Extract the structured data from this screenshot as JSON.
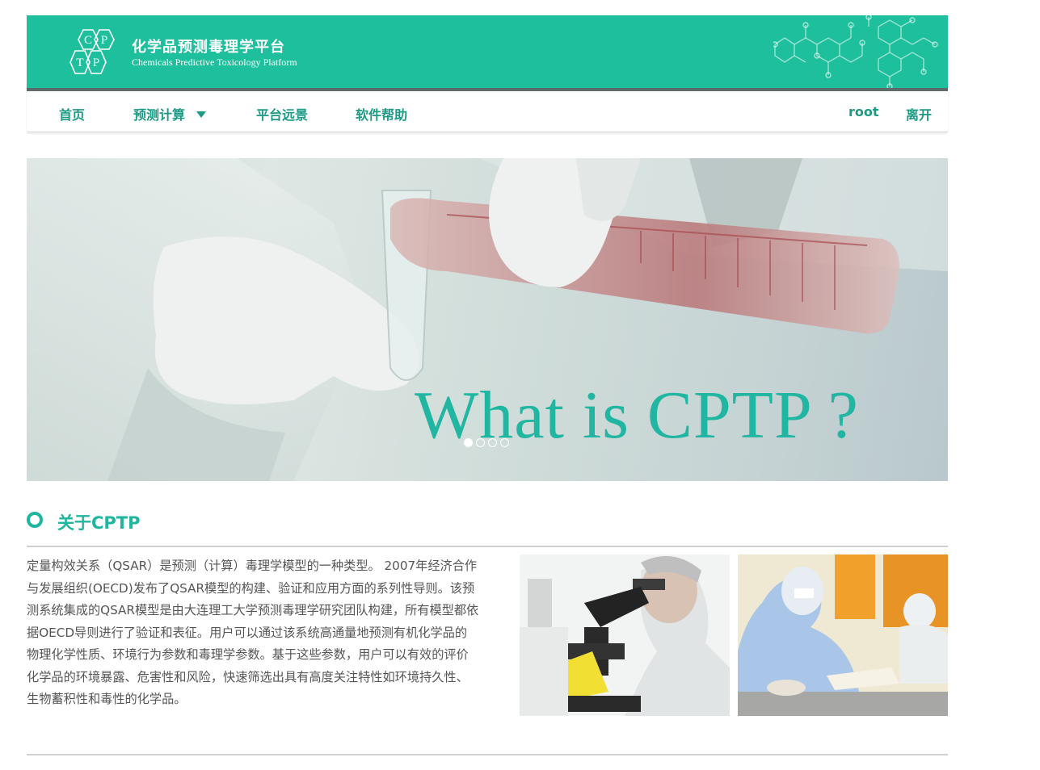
{
  "header": {
    "logo_letters": [
      "C",
      "P",
      "T",
      "P"
    ],
    "title_cn": "化学品预测毒理学平台",
    "title_en": "Chemicals Predictive Toxicology Platform",
    "brand_color": "#1ebf9c"
  },
  "nav": {
    "home": "首页",
    "predict": "预测计算",
    "vision": "平台远景",
    "help": "软件帮助",
    "user": "root",
    "logout": "离开"
  },
  "banner": {
    "title": "What is CPTP ?",
    "slide_count": 4,
    "active_slide": 1,
    "title_color": "#21b6a2"
  },
  "about": {
    "title": "关于CPTP",
    "text": "定量构效关系（QSAR）是预测（计算）毒理学模型的一种类型。 2007年经济合作与发展组织(OECD)发布了QSAR模型的构建、验证和应用方面的系列性导则。该预测系统集成的QSAR模型是由大连理工大学预测毒理学研究团队构建，所有模型都依据OECD导则进行了验证和表征。用户可以通过该系统高通量地预测有机化学品的物理化学性质、环境行为参数和毒理学参数。基于这些参数，用户可以有效的评价化学品的环境暴露、危害性和风险，快速筛选出具有高度关注特性如环境持久性、生物蓄积性和毒性的化学品。"
  }
}
